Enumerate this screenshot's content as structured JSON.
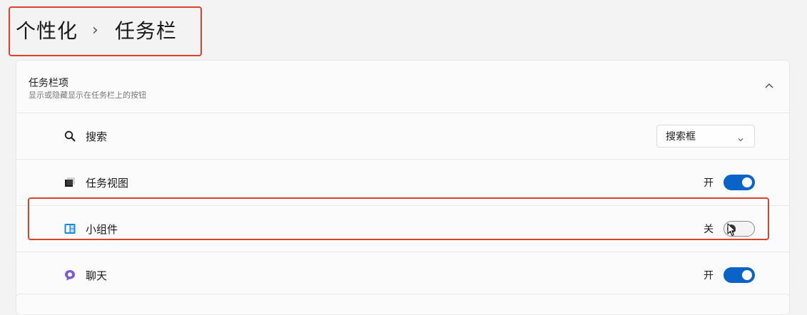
{
  "breadcrumb": {
    "parent": "个性化",
    "separator": "›",
    "current": "任务栏"
  },
  "taskbar_items": {
    "title": "任务栏项",
    "subtitle": "显示或隐藏显示在任务栏上的按钮",
    "expand_icon": "chevron-up-icon",
    "rows": [
      {
        "icon": "search-icon",
        "label": "搜索",
        "control": "dropdown",
        "value": "搜索框"
      },
      {
        "icon": "task-view-icon",
        "label": "任务视图",
        "control": "toggle",
        "state_label": "开",
        "on": true
      },
      {
        "icon": "widgets-icon",
        "label": "小组件",
        "control": "toggle",
        "state_label": "关",
        "on": false
      },
      {
        "icon": "chat-icon",
        "label": "聊天",
        "control": "toggle",
        "state_label": "开",
        "on": true
      }
    ]
  },
  "colors": {
    "accent": "#0a64c8",
    "highlight": "#d9432c",
    "chat_icon": "#7b5cd6",
    "widgets_icon": "#1e88e5"
  }
}
